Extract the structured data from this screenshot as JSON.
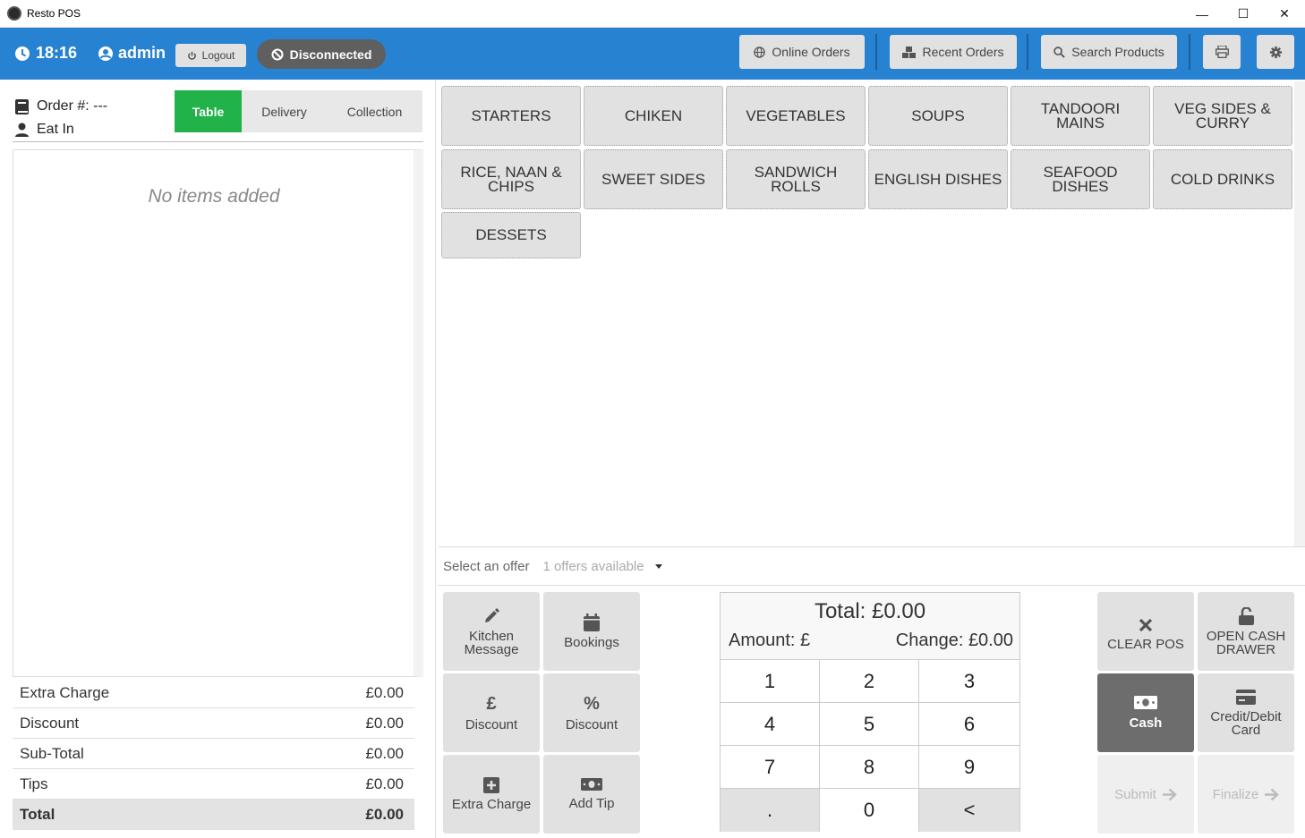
{
  "window": {
    "title": "Resto POS",
    "minimize": "—",
    "maximize": "☐",
    "close": "✕"
  },
  "header": {
    "time": "18:16",
    "user": "admin",
    "logout_label": "Logout",
    "status_label": "Disconnected",
    "online_orders_label": "Online Orders",
    "recent_orders_label": "Recent Orders",
    "search_products_label": "Search Products"
  },
  "order": {
    "number_label": "Order #: ---",
    "mode_label": "Eat In",
    "types": [
      "Table",
      "Delivery",
      "Collection"
    ],
    "empty_message": "No items added"
  },
  "totals": {
    "extra_charge": {
      "label": "Extra Charge",
      "value": "£0.00"
    },
    "discount": {
      "label": "Discount",
      "value": "£0.00"
    },
    "subtotal": {
      "label": "Sub-Total",
      "value": "£0.00"
    },
    "tips": {
      "label": "Tips",
      "value": "£0.00"
    },
    "total": {
      "label": "Total",
      "value": "£0.00"
    }
  },
  "categories": [
    "STARTERS",
    "CHIKEN",
    "VEGETABLES",
    "SOUPS",
    "TANDOORI MAINS",
    "VEG SIDES & CURRY",
    "RICE, NAAN & CHIPS",
    "SWEET SIDES",
    "SANDWICH ROLLS",
    "ENGLISH DISHES",
    "SEAFOOD DISHES",
    "COLD DRINKS",
    "DESSETS"
  ],
  "offer": {
    "label": "Select an offer",
    "value": "1 offers available"
  },
  "actions": {
    "kitchen_message": "Kitchen Message",
    "bookings": "Bookings",
    "discount_amount": "Discount",
    "discount_amount_symbol": "£",
    "discount_percent": "Discount",
    "discount_percent_symbol": "%",
    "extra_charge": "Extra Charge",
    "add_tip": "Add Tip",
    "clear_pos": "CLEAR POS",
    "open_cash_drawer": "OPEN CASH DRAWER",
    "cash": "Cash",
    "card": "Credit/Debit Card",
    "submit": "Submit",
    "finalize": "Finalize"
  },
  "keypad": {
    "total_label": "Total: £0.00",
    "amount_label": "Amount: £",
    "change_label": "Change: £0.00",
    "keys": [
      "1",
      "2",
      "3",
      "4",
      "5",
      "6",
      "7",
      "8",
      "9",
      ".",
      "0",
      "<"
    ]
  },
  "colors": {
    "header": "#2782d2",
    "active_tab": "#21b34a",
    "status_pill": "#5f5f5f",
    "cash_button": "#6d6d6d"
  }
}
